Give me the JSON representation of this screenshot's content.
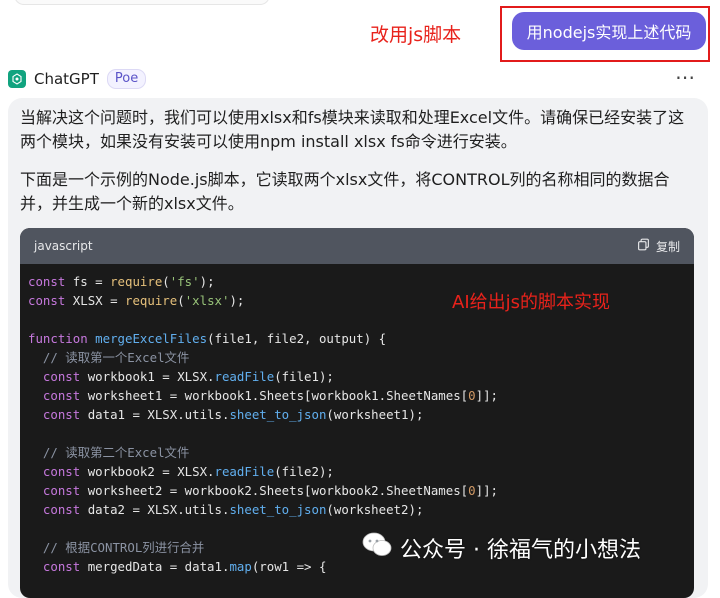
{
  "annotations": {
    "top_note": "改用js脚本",
    "code_note": "AI给出js的脚本实现"
  },
  "user_message": "用nodejs实现上述代码",
  "bot": {
    "name": "ChatGPT",
    "badge": "Poe",
    "more_icon": "⋯",
    "paragraph1": "当解决这个问题时，我们可以使用xlsx和fs模块来读取和处理Excel文件。请确保已经安装了这两个模块，如果没有安装可以使用npm install xlsx fs命令进行安装。",
    "paragraph2": "下面是一个示例的Node.js脚本，它读取两个xlsx文件，将CONTROL列的名称相同的数据合并，并生成一个新的xlsx文件。"
  },
  "code_block": {
    "language": "javascript",
    "copy_label": "复制",
    "lines": [
      "const fs = require('fs');",
      "const XLSX = require('xlsx');",
      "",
      "function mergeExcelFiles(file1, file2, output) {",
      "  // 读取第一个Excel文件",
      "  const workbook1 = XLSX.readFile(file1);",
      "  const worksheet1 = workbook1.Sheets[workbook1.SheetNames[0]];",
      "  const data1 = XLSX.utils.sheet_to_json(worksheet1);",
      "",
      "  // 读取第二个Excel文件",
      "  const workbook2 = XLSX.readFile(file2);",
      "  const worksheet2 = workbook2.Sheets[workbook2.SheetNames[0]];",
      "  const data2 = XLSX.utils.sheet_to_json(worksheet2);",
      "",
      "  // 根据CONTROL列进行合并",
      "  const mergedData = data1.map(row1 => {"
    ]
  },
  "watermark": {
    "text": "公众号 · 徐福气的小想法",
    "icon": "wechat-icon"
  },
  "colors": {
    "accent": "#6b5fdb",
    "annotation_red": "#e8221b",
    "code_bg": "#1a1a1a",
    "code_header_bg": "#50555f",
    "card_bg": "#f1f2f4"
  }
}
